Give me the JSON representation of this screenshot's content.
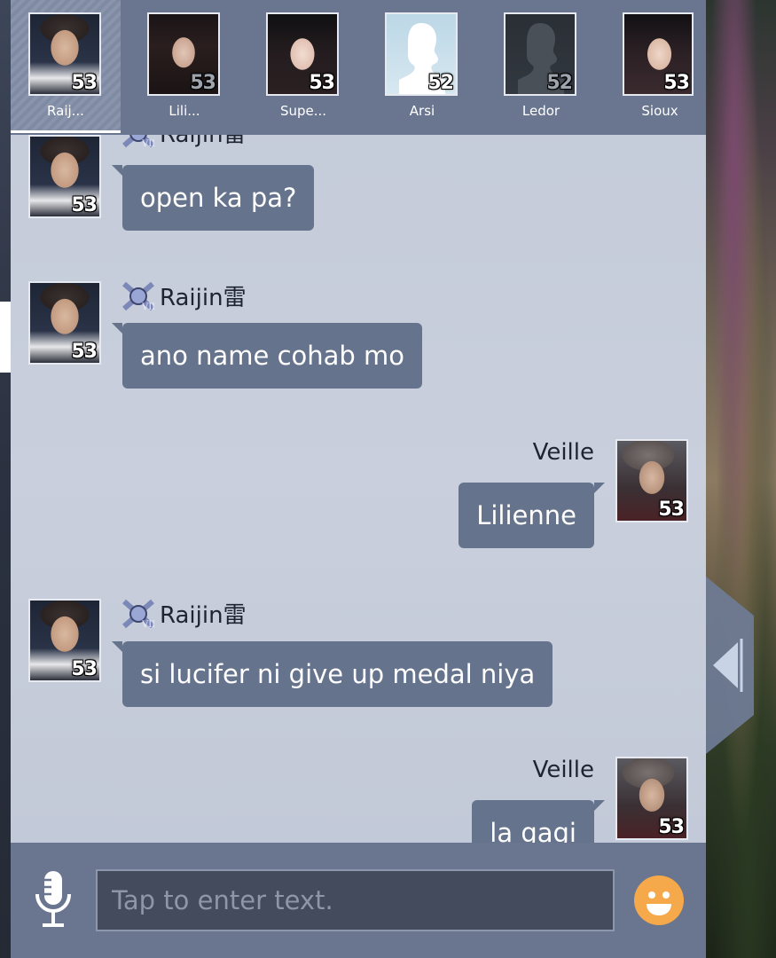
{
  "contacts": [
    {
      "name": "Raij...",
      "level": "53",
      "portrait": "male-suit",
      "active": true
    },
    {
      "name": "Lili...",
      "level": "53",
      "portrait": "female-dark",
      "active": false
    },
    {
      "name": "Supe...",
      "level": "53",
      "portrait": "female-light",
      "active": false
    },
    {
      "name": "Arsi",
      "level": "52",
      "portrait": "silhouette-light",
      "active": false
    },
    {
      "name": "Ledor",
      "level": "52",
      "portrait": "silhouette-dark",
      "active": false
    },
    {
      "name": "Sioux",
      "level": "53",
      "portrait": "female-third",
      "active": false
    }
  ],
  "messages": [
    {
      "sender": "Raijin雷",
      "level": "53",
      "text": "open ka pa?",
      "side": "left"
    },
    {
      "sender": "Raijin雷",
      "level": "53",
      "text": "ano name cohab mo",
      "side": "left"
    },
    {
      "sender": "Veille",
      "level": "53",
      "text": "Lilienne",
      "side": "right"
    },
    {
      "sender": "Raijin雷",
      "level": "53",
      "text": "si lucifer ni give up medal niya",
      "side": "left"
    },
    {
      "sender": "Veille",
      "level": "53",
      "text": "la gagi",
      "side": "right"
    }
  ],
  "input": {
    "placeholder": "Tap to enter text.",
    "value": ""
  },
  "icons": {
    "mic": "microphone-icon",
    "emoji": "emoji-smile-icon",
    "handle": "collapse-arrow-icon",
    "badge": "rank-badge-icon"
  },
  "colors": {
    "panel": "#c3cad9",
    "bar": "#6a7690",
    "bubble": "#66738c",
    "emoji": "#f5a94a"
  }
}
